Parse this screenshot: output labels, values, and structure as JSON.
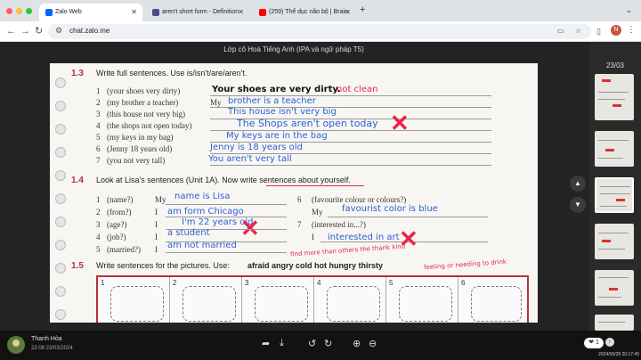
{
  "browser": {
    "tabs": [
      {
        "title": "Zalo Web",
        "icon": "zalo-icon",
        "color": "#0068ff"
      },
      {
        "title": "aren't short form - Definition",
        "icon": "dictionary-icon",
        "color": "#4a4a8a"
      },
      {
        "title": "(259) Thể dục não bộ | Brain",
        "icon": "youtube-icon",
        "color": "#ff0000"
      }
    ],
    "new_tab": "+",
    "url": "chat.zalo.me",
    "avatar_letter": "N"
  },
  "viewer": {
    "title": "Lớp cô Hoà Tiếng Anh (IPA và ngữ pháp T5)",
    "page_counter": "23/03"
  },
  "ex13": {
    "number": "1.3",
    "instruction": "Write full sentences. Use is/isn't/are/aren't.",
    "items": [
      {
        "num": "1",
        "prompt": "(your shoes very dirty)",
        "answer": "Your shoes are very dirty.",
        "mark": "not clean",
        "style": "black"
      },
      {
        "num": "2",
        "prompt": "(my brother a teacher)",
        "prefix": "My",
        "answer": "brother is a teacher"
      },
      {
        "num": "3",
        "prompt": "(this house not very big)",
        "answer": "This house isn't very big"
      },
      {
        "num": "4",
        "prompt": "(the shops not open today)",
        "answer": "The Shops aren't open today"
      },
      {
        "num": "5",
        "prompt": "(my keys in my bag)",
        "answer": "My keys are in the bag"
      },
      {
        "num": "6",
        "prompt": "(Jenny 18 years old)",
        "answer": "Jenny is 18 years old"
      },
      {
        "num": "7",
        "prompt": "(you not very tall)",
        "answer": "You aren't very tall"
      }
    ]
  },
  "ex14": {
    "number": "1.4",
    "instruction": "Look at Lisa's sentences (Unit 1A). Now write sentences about yourself.",
    "left": [
      {
        "num": "1",
        "prompt": "(name?)",
        "prefix": "My",
        "answer": "name is Lisa"
      },
      {
        "num": "2",
        "prompt": "(from?)",
        "prefix": "I",
        "answer": "am form Chicago"
      },
      {
        "num": "3",
        "prompt": "(age?)",
        "prefix": "I",
        "answer": "I'm 22 years old"
      },
      {
        "num": "4",
        "prompt": "(job?)",
        "prefix": "I",
        "answer": "a student"
      },
      {
        "num": "5",
        "prompt": "(married?)",
        "prefix": "I",
        "answer": "am not married"
      }
    ],
    "right": [
      {
        "num": "6",
        "prompt": "(favourite colour or colours?)",
        "prefix": "My",
        "answer": "favourist color is blue"
      },
      {
        "num": "7",
        "prompt": "(interested in...?)",
        "prefix": "I",
        "answer": "interested in art"
      }
    ],
    "teacher_note": "find more than others the thank kind"
  },
  "ex15": {
    "number": "1.5",
    "instruction": "Write sentences for the pictures. Use:",
    "words": "afraid  angry  cold  hot  hungry  thirsty",
    "note": "feeling or needing to drink",
    "frames": [
      "1",
      "2",
      "3",
      "4",
      "5",
      "6"
    ]
  },
  "footer": {
    "user": "Thanh Hòa",
    "time": "22:08 23/03/2024",
    "stamp": "2024/03/28 20:17:45"
  }
}
